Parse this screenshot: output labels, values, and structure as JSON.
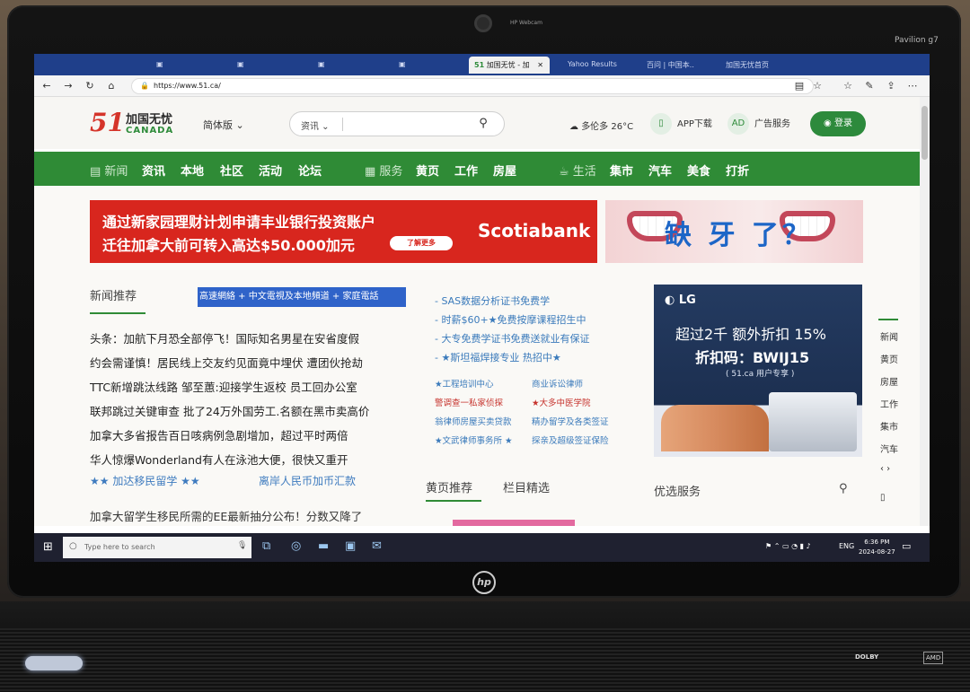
{
  "hardware": {
    "webcam_label": "HP Webcam",
    "model_label": "Pavilion g7",
    "logo": "hp",
    "dolby": "DOLBY",
    "amd": "AMD"
  },
  "browser": {
    "active_tab": "加国无忧 - 加",
    "other_tabs": [
      "Yahoo Results",
      "百问 | 中国本..",
      "加国无忧首页"
    ],
    "url": "https://www.51.ca/"
  },
  "site": {
    "logo_number": "51",
    "logo_cn": "加国无忧",
    "logo_en": "CANADA",
    "language": "简体版",
    "search_category": "资讯",
    "weather": "多伦多 26°C",
    "app_download": "APP下载",
    "ad_service": "广告服务",
    "login": "登录"
  },
  "nav": {
    "news_group": "新闻",
    "news_items": [
      "资讯",
      "本地",
      "社区",
      "活动",
      "论坛"
    ],
    "service_group": "服务",
    "service_items": [
      "黄页",
      "工作",
      "房屋"
    ],
    "life_group": "生活",
    "life_items": [
      "集市",
      "汽车",
      "美食",
      "打折"
    ]
  },
  "banner_ads": {
    "scotia_line1": "通过新家园理财计划申请丰业银行投资账户",
    "scotia_line2": "迁往加拿大前可转入高达$50.000加元",
    "scotia_more": "了解更多",
    "scotia_brand": "Scotiabank",
    "dental_text": "缺 牙 了？"
  },
  "news": {
    "section_title": "新闻推荐",
    "highlight": "高速網絡 + 中文電視及本地頻道 + 家庭電話",
    "headlines": [
      "头条：加航下月恐全部停飞！国际知名男星在安省度假",
      "约会需谨慎！居民线上交友约见面竟中埋伏 遭团伙抢劫",
      "TTC新增跳汰线路 邹至蕙:迎接学生返校 员工回办公室",
      "联邦跳过关键审查 批了24万外国劳工.名额在黑市卖高价",
      "加拿大多省报告百日咳病例急剧增加，超过平时两倍",
      "华人惊爆Wonderland有人在泳池大便，很快又重开"
    ],
    "star_left": "★★ 加达移民留学 ★★",
    "star_right": "离岸人民币加币汇款",
    "bottom_headline": "加拿大留学生移民所需的EE最新抽分公布！分数又降了"
  },
  "mid_column": {
    "links": [
      "- SAS数据分析证书免费学",
      "- 时薪$60+★免费按摩课程招生中",
      "- 大专免费学证书免费送就业有保证",
      "- ★斯坦福焊接专业 热招中★"
    ],
    "grid": [
      "★工程培训中心",
      "商业诉讼律师",
      "警调查一私家侦探",
      "★大多中医学院",
      "翁律师房屋买卖贷款",
      "精办留学及各类签证",
      "★文武律师事务所 ★",
      "探亲及超级签证保险"
    ],
    "tab_yellow": "黄页推荐",
    "tab_picks": "栏目精选"
  },
  "lg_ad": {
    "logo": "LG",
    "line1": "超过2千  额外折扣 15%",
    "line2": "折扣码：BWIJ15",
    "line3": "( 51.ca 用户专享 )"
  },
  "preferred": {
    "title": "优选服务"
  },
  "side_rail": [
    "新闻",
    "黄页",
    "房屋",
    "工作",
    "集市",
    "汽车"
  ],
  "taskbar": {
    "search_placeholder": "Type here to search",
    "lang": "ENG",
    "time": "6:36 PM",
    "date": "2024-08-27"
  }
}
